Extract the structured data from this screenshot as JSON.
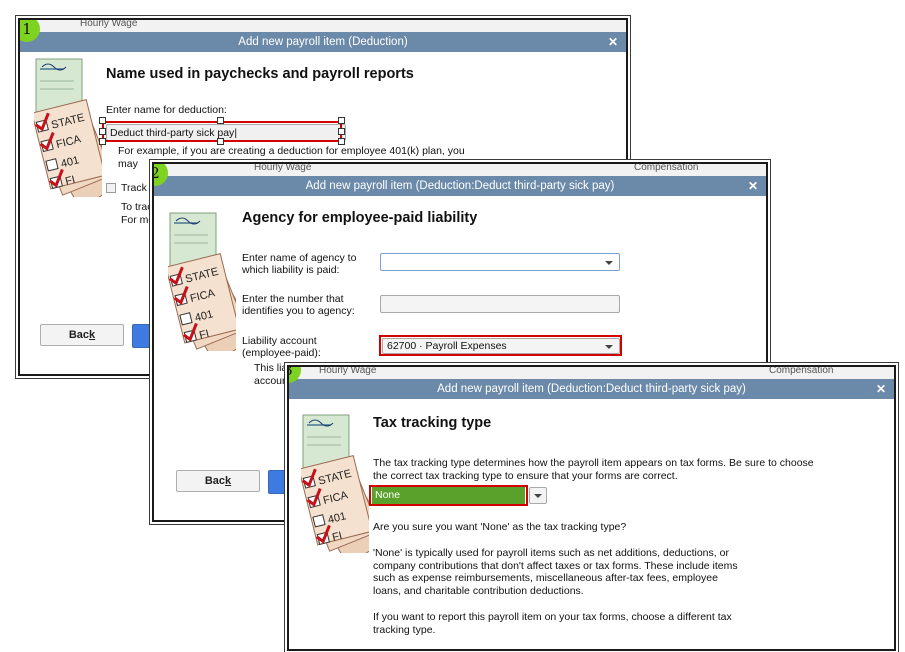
{
  "dialog1": {
    "step": "1",
    "title": "Add new payroll item (Deduction)",
    "bg_text": "Hourly Wage",
    "heading": "Name used in paychecks and payroll reports",
    "name_label": "Enter name for deduction:",
    "name_value": "Deduct third-party sick pay",
    "example_line1": "For example, if you are creating a deduction for employee 401(k) plan, you",
    "example_line2": "may",
    "track_label": "Track",
    "to_track_line1": "To trac",
    "to_track_line2": "For mo",
    "back_label": "Back",
    "back_mnemonic": "k"
  },
  "dialog2": {
    "step": "2",
    "title": "Add new payroll item (Deduction:Deduct third-party sick pay)",
    "bg_text_left": "Hourly Wage",
    "bg_text_right": "Compensation",
    "heading": "Agency for employee-paid liability",
    "agency_label_1": "Enter name of agency to",
    "agency_label_2": "which liability is paid:",
    "agency_value": "",
    "number_label_1": "Enter the number that",
    "number_label_2": "identifies you to agency:",
    "number_value": "",
    "liability_label_1": "Liability account",
    "liability_label_2": "(employee-paid):",
    "liability_value": "62700 · Payroll Expenses",
    "note_line1": "This liability account tracks deductions to be paid. You can change this",
    "note_line2": "account",
    "back_label": "Back",
    "back_mnemonic": "k"
  },
  "dialog3": {
    "step": "3",
    "title": "Add new payroll item (Deduction:Deduct third-party sick pay)",
    "bg_text_left": "Hourly Wage",
    "bg_text_right": "Compensation",
    "heading": "Tax tracking type",
    "desc_line1": "The tax tracking type determines how the payroll item appears on tax forms.  Be sure to choose",
    "desc_line2": "the correct tax tracking type to ensure that your forms are correct.",
    "tracking_value": "None",
    "confirm": "Are you sure you want 'None' as the tax tracking type?",
    "info_line1": "'None' is typically used for payroll items such as net additions, deductions, or",
    "info_line2": "company contributions that don't affect taxes or tax forms.  These include items",
    "info_line3": "such as expense reimbursements, miscellaneous after-tax fees, employee",
    "info_line4": "loans, and charitable contribution deductions.",
    "report_line1": "If you want to report this payroll item on your tax forms, choose a different tax",
    "report_line2": "tracking type."
  },
  "art": {
    "state": "STATE",
    "fica": "FICA",
    "k401": "401",
    "fi": "FI",
    "sig": "Pay"
  },
  "colors": {
    "titlebar": "#6b8aa9",
    "highlight_red": "#d40000",
    "badge_green": "#7ed321",
    "selected_green": "#5aa12b",
    "primary_blue": "#3e7be0"
  }
}
